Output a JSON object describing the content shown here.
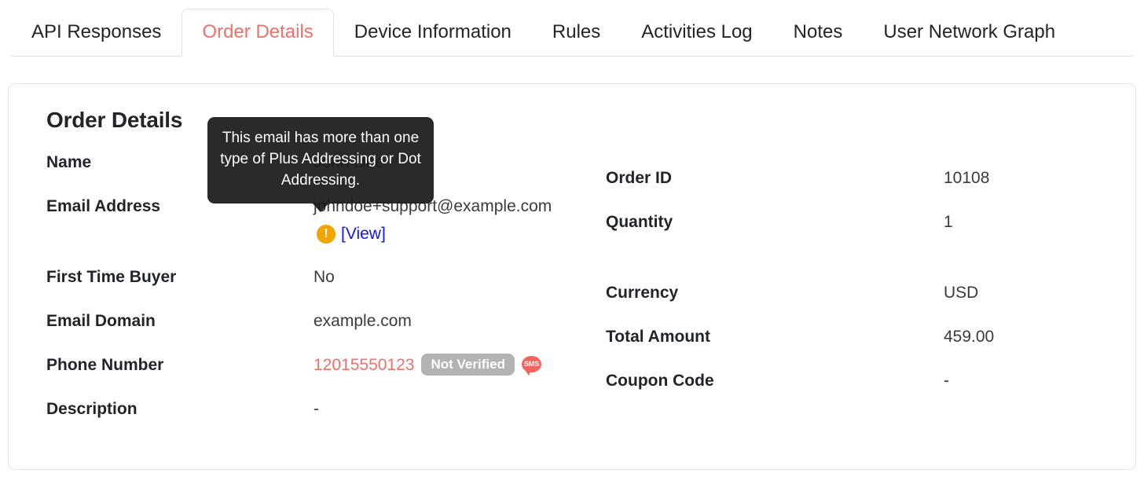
{
  "tabs": [
    {
      "label": "API Responses",
      "active": false
    },
    {
      "label": "Order Details",
      "active": true
    },
    {
      "label": "Device Information",
      "active": false
    },
    {
      "label": "Rules",
      "active": false
    },
    {
      "label": "Activities Log",
      "active": false
    },
    {
      "label": "Notes",
      "active": false
    },
    {
      "label": "User Network Graph",
      "active": false
    }
  ],
  "card": {
    "title": "Order Details",
    "left_column": [
      {
        "label": "Name",
        "value": "John Doe"
      },
      {
        "label": "Email Address",
        "value": "johndoe+support@example.com"
      },
      {
        "label": "First Time Buyer",
        "value": "No"
      },
      {
        "label": "Email Domain",
        "value": "example.com"
      },
      {
        "label": "Phone Number",
        "value": "12015550123"
      },
      {
        "label": "Description",
        "value": "-"
      }
    ],
    "right_column": [
      {
        "label": "Order ID",
        "value": "10108"
      },
      {
        "label": "Quantity",
        "value": "1"
      },
      {
        "label": "Currency",
        "value": "USD"
      },
      {
        "label": "Total Amount",
        "value": "459.00"
      },
      {
        "label": "Coupon Code",
        "value": "-"
      }
    ],
    "email_warning": {
      "icon": "exclamation-circle-icon",
      "view_link": "[View]",
      "tooltip": "This email has more than one type of Plus Addressing or Dot Addressing."
    },
    "phone_badges": {
      "verification": "Not Verified",
      "channel": "SMS"
    }
  },
  "colors": {
    "accent": "#f1706b",
    "link": "#1414ff",
    "warning": "#f0a500",
    "badge_gray": "#b3b3b3",
    "sms_red": "#f5635e",
    "tooltip_bg": "#1a1a1a"
  }
}
